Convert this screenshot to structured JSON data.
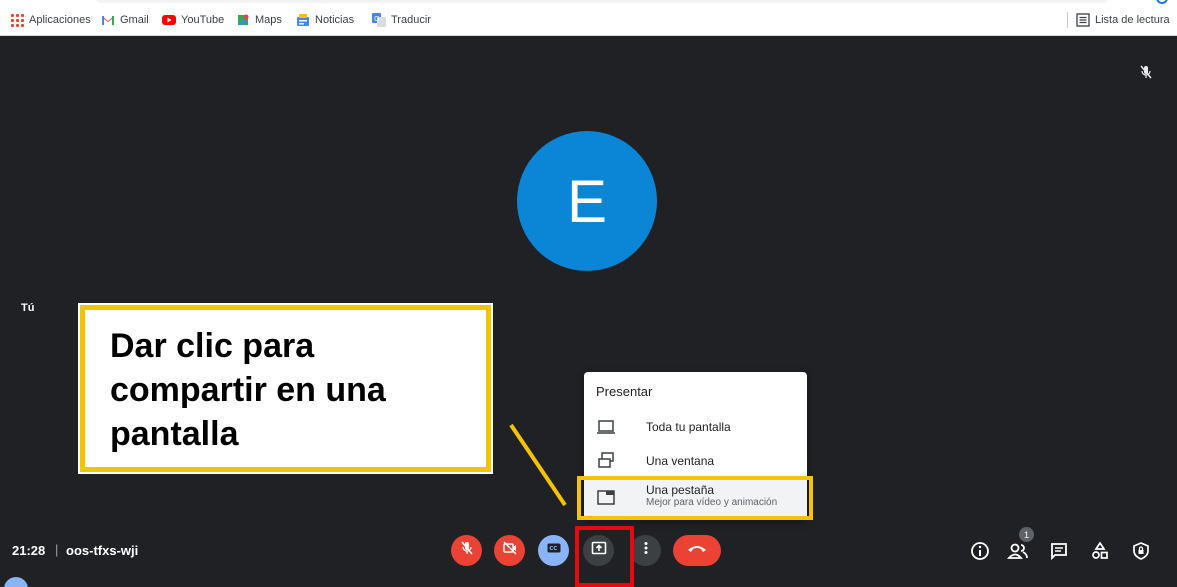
{
  "bookmarks": {
    "items": [
      {
        "label": "Aplicaciones",
        "icon": "apps-grid-icon"
      },
      {
        "label": "Gmail",
        "icon": "gmail-icon"
      },
      {
        "label": "YouTube",
        "icon": "youtube-icon"
      },
      {
        "label": "Maps",
        "icon": "maps-icon"
      },
      {
        "label": "Noticias",
        "icon": "news-icon"
      },
      {
        "label": "Traducir",
        "icon": "translate-icon"
      }
    ],
    "reading_list": "Lista de lectura"
  },
  "stage": {
    "avatar_letter": "E",
    "avatar_color": "#0b85d6",
    "participant_label": "Tú"
  },
  "callout": {
    "text": "Dar clic para compartir en una pantalla",
    "border_color": "#f5c400"
  },
  "present_menu": {
    "title": "Presentar",
    "items": [
      {
        "label": "Toda tu pantalla",
        "icon": "monitor-icon"
      },
      {
        "label": "Una ventana",
        "icon": "window-icon"
      },
      {
        "label": "Una pestaña",
        "icon": "tab-icon",
        "sublabel": "Mejor para vídeo y animación"
      }
    ]
  },
  "bottombar": {
    "time": "21:28",
    "separator": "|",
    "meeting_code": "oos-tfxs-wji",
    "people_count": "1",
    "colors": {
      "danger": "#ea4335",
      "captions": "#8ab4f8",
      "highlight_red": "#e50914"
    }
  }
}
